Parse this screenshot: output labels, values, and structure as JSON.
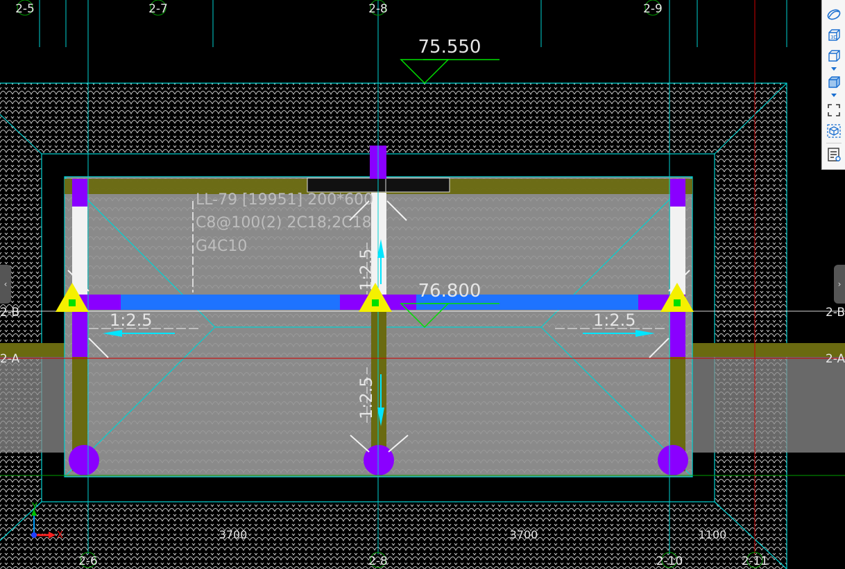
{
  "drawing": {
    "axes_top": [
      "2-5",
      "2-7",
      "2-8",
      "2-9"
    ],
    "axes_bottom": [
      "2-6",
      "2-8",
      "2-10",
      "2-11"
    ],
    "axes_side": [
      "2-B",
      "2-A"
    ],
    "elevation_top": "75.550",
    "elevation_mid": "76.800",
    "beam_name": "LL-79 [19951] 200*600",
    "beam_stirrup": "C8@100(2) 2C18;2C18",
    "beam_side": "G4C10",
    "slope_left": "1:2.5",
    "slope_right": "1:2.5",
    "slope_up": "1:2.5",
    "slope_down": "1:2.5",
    "dims": [
      "3700",
      "3700",
      "1100"
    ],
    "ucs_x": "X",
    "ucs_y": "Y"
  },
  "toolbar": {
    "buttons": [
      "view-cube-icon",
      "3d-view-icon",
      "wireframe-box-icon",
      "shaded-box-icon",
      "zoom-extents-icon",
      "component-view-icon",
      "properties-panel-icon"
    ]
  },
  "colors": {
    "background": "#000000",
    "axis_line": "#00d2d2",
    "hatch": "#c8c8c8",
    "beam": "#6a6a10",
    "column": "#8a00ff",
    "selected_beam": "#1e73ff",
    "elevation_marker": "#00e000",
    "slope_arrow": "#00e5ff",
    "pile_marker": "#f5f000"
  },
  "side_tabs": {
    "left": "‹",
    "right": "›"
  }
}
